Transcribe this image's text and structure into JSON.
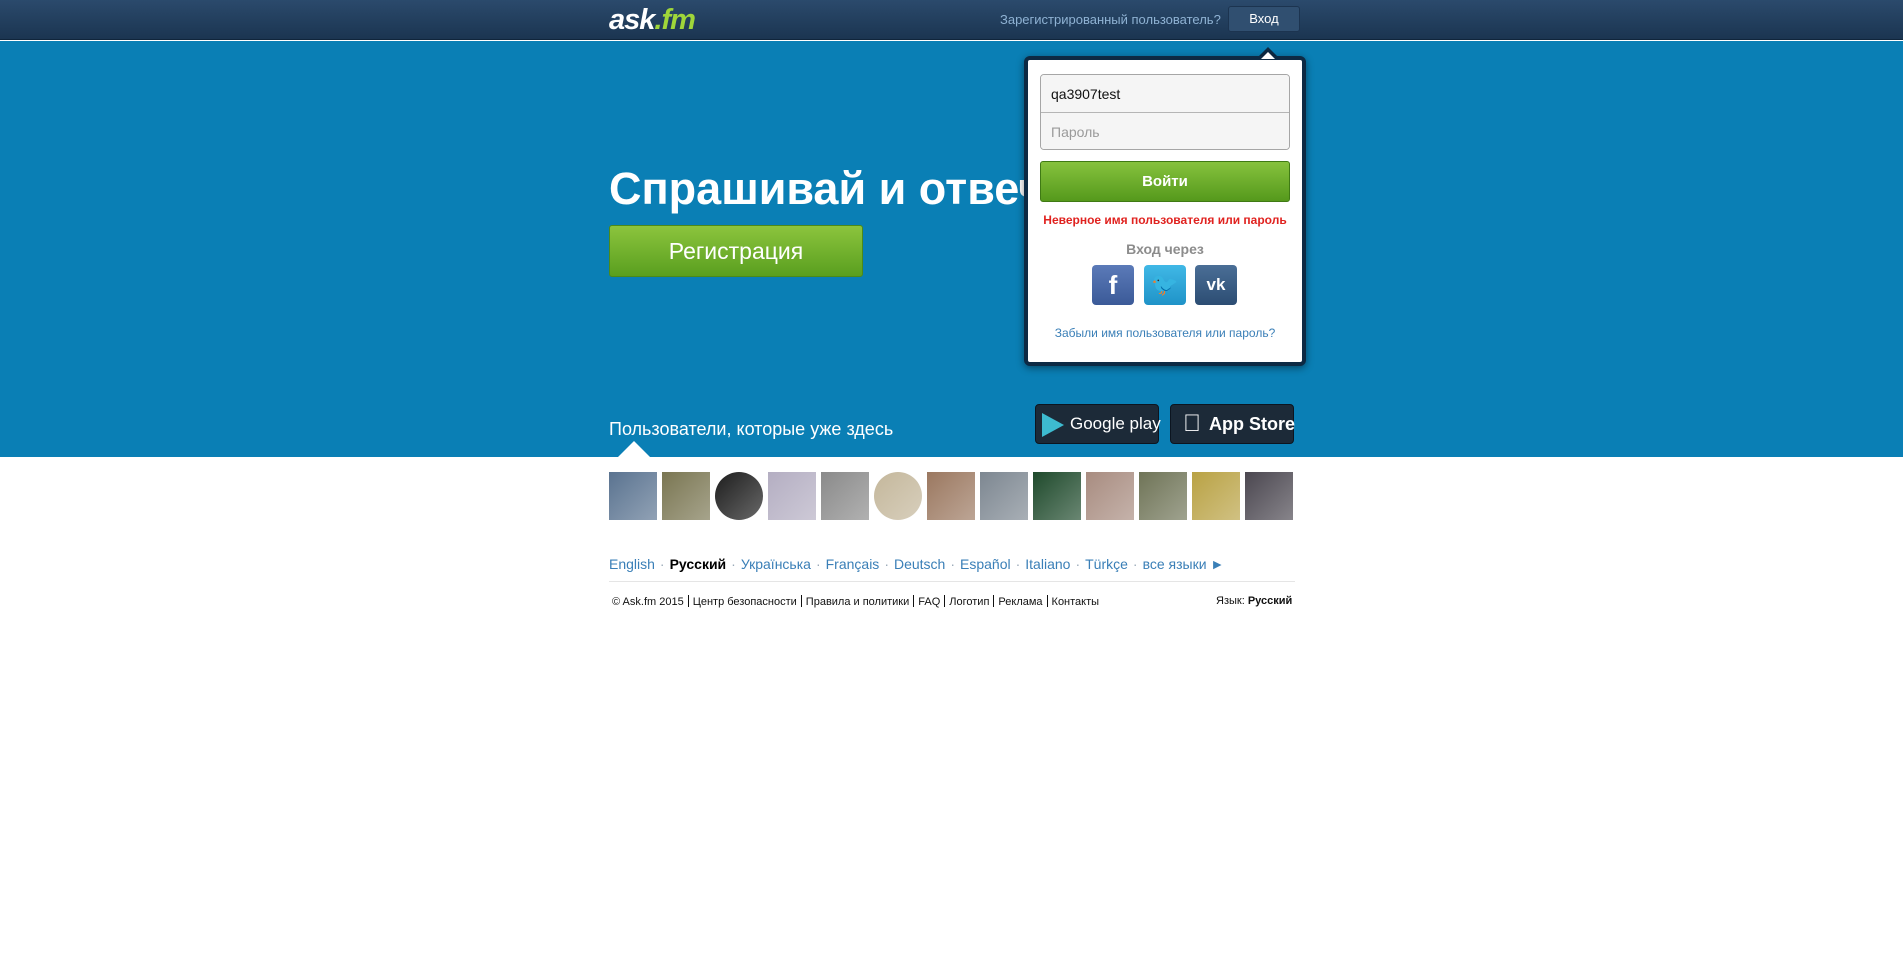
{
  "header": {
    "logo_main": "ask",
    "logo_accent": ".fm",
    "registered_question": "Зарегистрированный пользователь?",
    "login_button": "Вход"
  },
  "hero": {
    "title": "Спрашивай и отвечай!",
    "signup_button": "Регистрация",
    "users_here": "Пользователи, которые уже здесь",
    "google_play": "Google play",
    "app_store": "App Store"
  },
  "login_popup": {
    "username_value": "qa3907test",
    "password_placeholder": "Пароль",
    "submit": "Войти",
    "error": "Неверное имя пользователя или пароль",
    "via_label": "Вход через",
    "facebook": "f",
    "twitter": "t",
    "vk": "vk",
    "forgot": "Забыли имя пользователя или пароль?"
  },
  "avatars": [
    {
      "color": "#5a7390"
    },
    {
      "color": "#7a7652"
    },
    {
      "color": "#1d1d1d"
    },
    {
      "color": "#b4aec2"
    },
    {
      "color": "#8a8a8a"
    },
    {
      "color": "#c4b79b"
    },
    {
      "color": "#9b7860"
    },
    {
      "color": "#7d8791"
    },
    {
      "color": "#1f4a2c"
    },
    {
      "color": "#a88c80"
    },
    {
      "color": "#6f7457"
    },
    {
      "color": "#b9a244"
    },
    {
      "color": "#4b4750"
    }
  ],
  "languages": {
    "items": [
      "English",
      "Русский",
      "Українська",
      "Français",
      "Deutsch",
      "Español",
      "Italiano",
      "Türkçe",
      "все языки ►"
    ],
    "selected": "Русский",
    "separator": "·"
  },
  "footer": {
    "links": [
      "© Ask.fm 2015",
      "Центр безопасности",
      "Правила и политики",
      "FAQ",
      "Логотип",
      "Реклама",
      "Контакты"
    ],
    "language_label": "Язык:",
    "language_value": "Русский"
  }
}
